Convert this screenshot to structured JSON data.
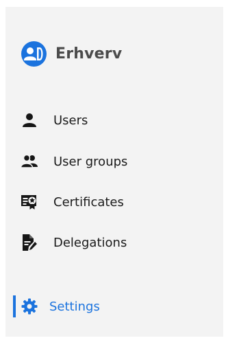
{
  "brand": {
    "name": "Erhverv",
    "logo_icon": "user-badge-logo",
    "accent": "#1b73de"
  },
  "nav": {
    "items": [
      {
        "label": "Users",
        "icon": "user-icon"
      },
      {
        "label": "User groups",
        "icon": "user-group-icon"
      },
      {
        "label": "Certificates",
        "icon": "certificate-icon"
      },
      {
        "label": "Delegations",
        "icon": "delegation-icon"
      }
    ],
    "settings": {
      "label": "Settings",
      "icon": "gear-icon",
      "active": true
    }
  }
}
